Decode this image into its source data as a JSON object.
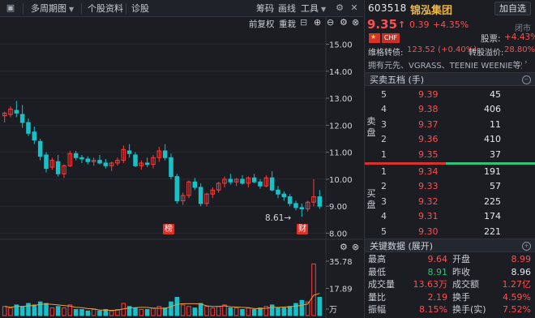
{
  "toolbar": {
    "period_label": "多周期图",
    "dropdown_glyph": "▼",
    "stock_info_label": "个股资料",
    "diagnose_label": "诊股",
    "chips_label": "筹码",
    "draw_label": "画线",
    "tools_label": "工具"
  },
  "chart": {
    "adjust_label": "前复权",
    "overlay_label": "重栽",
    "price_ticks": [
      "15.00",
      "14.00",
      "13.00",
      "12.00",
      "11.00",
      "10.00",
      "9.00",
      "8.00"
    ],
    "low_marker": "8.61→",
    "event_flag_1": "榜",
    "event_flag_2": "财",
    "volume_ticks": [
      "35.78",
      "17.89",
      "万"
    ],
    "up_color": "#ff3b3b",
    "down_color": "#18c0c8",
    "ma_color": "#e9a23a"
  },
  "chart_data": {
    "type": "candlestick",
    "ylim": [
      8.0,
      15.0
    ],
    "candles": [
      [
        12.35,
        12.5,
        12.1,
        12.45
      ],
      [
        12.4,
        12.7,
        12.3,
        12.6
      ],
      [
        12.55,
        12.9,
        12.3,
        12.45
      ],
      [
        12.4,
        12.75,
        11.9,
        12.1
      ],
      [
        12.1,
        12.25,
        11.6,
        11.7
      ],
      [
        11.75,
        11.95,
        11.3,
        11.45
      ],
      [
        11.4,
        11.5,
        10.7,
        10.85
      ],
      [
        10.9,
        11.0,
        10.25,
        10.4
      ],
      [
        10.45,
        10.8,
        10.35,
        10.7
      ],
      [
        10.65,
        10.9,
        10.1,
        10.2
      ],
      [
        10.2,
        10.55,
        10.05,
        10.5
      ],
      [
        10.5,
        11.05,
        10.45,
        10.95
      ],
      [
        10.95,
        11.05,
        10.7,
        10.8
      ],
      [
        10.8,
        10.9,
        10.6,
        10.75
      ],
      [
        10.75,
        10.85,
        10.55,
        10.65
      ],
      [
        10.65,
        10.8,
        10.5,
        10.7
      ],
      [
        10.7,
        10.9,
        10.55,
        10.6
      ],
      [
        10.6,
        10.75,
        10.4,
        10.5
      ],
      [
        10.5,
        10.65,
        10.3,
        10.6
      ],
      [
        10.6,
        10.8,
        10.5,
        10.7
      ],
      [
        10.7,
        11.25,
        10.6,
        11.1
      ],
      [
        11.05,
        11.3,
        10.8,
        10.95
      ],
      [
        10.9,
        11.0,
        10.45,
        10.5
      ],
      [
        10.5,
        10.7,
        10.35,
        10.6
      ],
      [
        10.6,
        10.8,
        10.45,
        10.55
      ],
      [
        10.55,
        10.9,
        10.4,
        10.8
      ],
      [
        10.8,
        11.2,
        10.65,
        11.05
      ],
      [
        11.05,
        11.3,
        10.7,
        10.8
      ],
      [
        10.8,
        10.95,
        10.0,
        10.1
      ],
      [
        10.1,
        10.2,
        9.1,
        9.2
      ],
      [
        9.2,
        9.5,
        9.05,
        9.4
      ],
      [
        9.4,
        9.95,
        9.3,
        9.9
      ],
      [
        9.9,
        10.05,
        9.6,
        9.7
      ],
      [
        9.7,
        9.85,
        9.0,
        9.1
      ],
      [
        9.1,
        9.5,
        9.0,
        9.45
      ],
      [
        9.45,
        9.7,
        9.3,
        9.6
      ],
      [
        9.6,
        9.9,
        9.5,
        9.85
      ],
      [
        9.85,
        10.1,
        9.7,
        10.0
      ],
      [
        10.0,
        10.2,
        9.8,
        9.9
      ],
      [
        9.9,
        10.05,
        9.75,
        10.0
      ],
      [
        10.0,
        10.15,
        9.8,
        9.85
      ],
      [
        9.85,
        10.1,
        9.7,
        10.05
      ],
      [
        10.05,
        10.2,
        9.85,
        9.9
      ],
      [
        9.9,
        10.0,
        9.65,
        9.75
      ],
      [
        9.75,
        10.15,
        9.7,
        10.05
      ],
      [
        10.05,
        10.3,
        9.55,
        9.6
      ],
      [
        9.6,
        9.75,
        9.3,
        9.45
      ],
      [
        9.45,
        9.55,
        9.2,
        9.35
      ],
      [
        9.35,
        9.45,
        9.0,
        9.1
      ],
      [
        9.1,
        9.2,
        8.85,
        8.95
      ],
      [
        8.95,
        9.1,
        8.61,
        8.9
      ],
      [
        8.9,
        9.2,
        8.8,
        9.15
      ],
      [
        9.15,
        10.0,
        9.0,
        9.35
      ],
      [
        9.35,
        9.6,
        8.9,
        9.0
      ]
    ],
    "volume": [
      6,
      5,
      7,
      6,
      8,
      7,
      9,
      8,
      5,
      6,
      5,
      7,
      4,
      4,
      3,
      4,
      3,
      4,
      3,
      4,
      8,
      6,
      5,
      4,
      4,
      5,
      6,
      5,
      9,
      12,
      7,
      6,
      5,
      8,
      6,
      5,
      6,
      7,
      5,
      5,
      4,
      5,
      4,
      5,
      6,
      7,
      5,
      5,
      6,
      8,
      10,
      9,
      34,
      12
    ]
  },
  "panel": {
    "code": "603518",
    "name": "锦泓集团",
    "add_button": "加自选",
    "price": "9.35",
    "price_arrow": "↑",
    "change": "0.39",
    "change_pct": "+4.35%",
    "status": "闭市",
    "flag_text": "CHF",
    "stock_chg_label": "股票:",
    "stock_chg_value": "+4.43%",
    "bond_label": "维格转债:",
    "bond_value": "123.52 (+0.40%)",
    "premium_label": "转股溢价:",
    "premium_value": "28.80%",
    "concepts": "拥有元先、VGRASS、TEENIE WEENIE等知...",
    "orderbook_title": "买卖五档 (手)",
    "ask_side": "卖盘",
    "bid_side": "买盘",
    "asks": [
      {
        "level": "5",
        "price": "9.39",
        "vol": "45"
      },
      {
        "level": "4",
        "price": "9.38",
        "vol": "406"
      },
      {
        "level": "3",
        "price": "9.37",
        "vol": "11"
      },
      {
        "level": "2",
        "price": "9.36",
        "vol": "410"
      },
      {
        "level": "1",
        "price": "9.35",
        "vol": "37"
      }
    ],
    "bids": [
      {
        "level": "1",
        "price": "9.34",
        "vol": "191"
      },
      {
        "level": "2",
        "price": "9.33",
        "vol": "57"
      },
      {
        "level": "3",
        "price": "9.32",
        "vol": "225"
      },
      {
        "level": "4",
        "price": "9.31",
        "vol": "174"
      },
      {
        "level": "5",
        "price": "9.30",
        "vol": "221"
      }
    ],
    "keydata_title": "关键数据 (展开)",
    "keydata": [
      {
        "l1": "最高",
        "v1": "9.64",
        "l2": "开盘",
        "v2": "8.99"
      },
      {
        "l1": "最低",
        "v1": "8.91",
        "l2": "昨收",
        "v2": "8.96"
      },
      {
        "l1": "成交量",
        "v1": "13.63万",
        "l2": "成交额",
        "v2": "1.27亿"
      },
      {
        "l1": "量比",
        "v1": "2.19",
        "l2": "换手",
        "v2": "4.59%"
      },
      {
        "l1": "振幅",
        "v1": "8.15%",
        "l2": "换手(实)",
        "v2": "7.52%"
      }
    ]
  }
}
